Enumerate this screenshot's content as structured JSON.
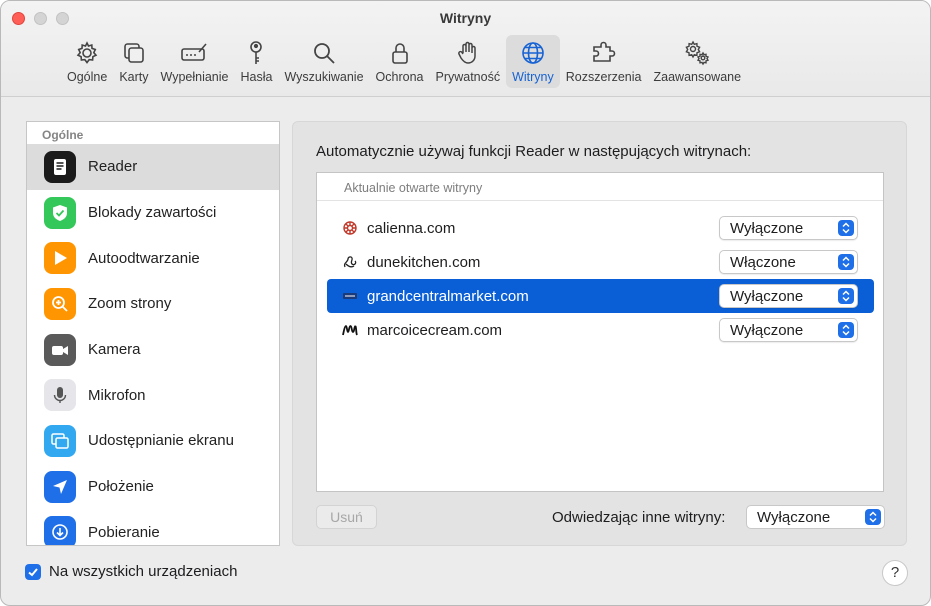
{
  "window": {
    "title": "Witryny"
  },
  "toolbar": {
    "items": [
      {
        "label": "Ogólne",
        "icon": "gear-icon"
      },
      {
        "label": "Karty",
        "icon": "tabs-icon"
      },
      {
        "label": "Wypełnianie",
        "icon": "autofill-icon"
      },
      {
        "label": "Hasła",
        "icon": "key-icon"
      },
      {
        "label": "Wyszukiwanie",
        "icon": "search-icon"
      },
      {
        "label": "Ochrona",
        "icon": "lock-icon"
      },
      {
        "label": "Prywatność",
        "icon": "hand-icon"
      },
      {
        "label": "Witryny",
        "icon": "globe-icon"
      },
      {
        "label": "Rozszerzenia",
        "icon": "puzzle-icon"
      },
      {
        "label": "Zaawansowane",
        "icon": "gears-icon"
      }
    ],
    "active": "Witryny"
  },
  "sidebar": {
    "header": "Ogólne",
    "items": [
      {
        "label": "Reader",
        "icon": "reader-icon",
        "color": "#1b1b1b"
      },
      {
        "label": "Blokady zawartości",
        "icon": "shield-check-icon",
        "color": "#34c759"
      },
      {
        "label": "Autoodtwarzanie",
        "icon": "play-icon",
        "color": "#ff9500"
      },
      {
        "label": "Zoom strony",
        "icon": "zoom-icon",
        "color": "#ff9500"
      },
      {
        "label": "Kamera",
        "icon": "camera-icon",
        "color": "#5a5a5a"
      },
      {
        "label": "Mikrofon",
        "icon": "microphone-icon",
        "color": "#8e8e93"
      },
      {
        "label": "Udostępnianie ekranu",
        "icon": "screen-share-icon",
        "color": "#32a8f0"
      },
      {
        "label": "Położenie",
        "icon": "location-icon",
        "color": "#1f6fe8"
      },
      {
        "label": "Pobieranie",
        "icon": "download-icon",
        "color": "#1f6fe8"
      }
    ],
    "selected": "Reader"
  },
  "panel": {
    "description": "Automatycznie używaj funkcji Reader w następujących witrynach:",
    "list_header": "Aktualnie otwarte witryny",
    "rows": [
      {
        "site": "calienna.com",
        "value": "Wyłączone"
      },
      {
        "site": "dunekitchen.com",
        "value": "Włączone"
      },
      {
        "site": "grandcentralmarket.com",
        "value": "Wyłączone"
      },
      {
        "site": "marcoicecream.com",
        "value": "Wyłączone"
      }
    ],
    "selected_row": "grandcentralmarket.com",
    "remove_label": "Usuń",
    "other_label": "Odwiedzając inne witryny:",
    "other_value": "Wyłączone"
  },
  "footer": {
    "checkbox_label": "Na wszystkich urządzeniach",
    "help_label": "?"
  }
}
